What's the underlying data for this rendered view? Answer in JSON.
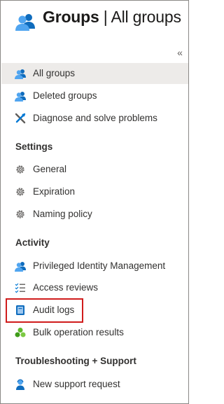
{
  "header": {
    "title_bold": "Groups",
    "title_sep": " | ",
    "title_rest": "All groups",
    "icon": "groups-icon"
  },
  "collapse": {
    "glyph": "«",
    "icon": "collapse-chevron-icon"
  },
  "nav": {
    "top": [
      {
        "label": "All groups",
        "icon": "groups-icon",
        "selected": true
      },
      {
        "label": "Deleted groups",
        "icon": "groups-icon"
      },
      {
        "label": "Diagnose and solve problems",
        "icon": "wrench-icon"
      }
    ],
    "settings": {
      "heading": "Settings",
      "items": [
        {
          "label": "General",
          "icon": "gear-icon"
        },
        {
          "label": "Expiration",
          "icon": "gear-icon"
        },
        {
          "label": "Naming policy",
          "icon": "gear-icon"
        }
      ]
    },
    "activity": {
      "heading": "Activity",
      "items": [
        {
          "label": "Privileged Identity Management",
          "icon": "groups-icon"
        },
        {
          "label": "Access reviews",
          "icon": "checklist-icon"
        },
        {
          "label": "Audit logs",
          "icon": "book-icon",
          "highlighted": true
        },
        {
          "label": "Bulk operation results",
          "icon": "bulk-icon"
        }
      ]
    },
    "support": {
      "heading": "Troubleshooting + Support",
      "items": [
        {
          "label": "New support request",
          "icon": "support-person-icon"
        }
      ]
    }
  },
  "colors": {
    "selected_bg": "#edebe9",
    "highlight_border": "#d01c1c",
    "icon_blue": "#0078d4",
    "icon_green": "#5db82b"
  }
}
